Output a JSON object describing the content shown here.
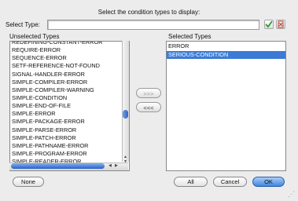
{
  "dialog": {
    "prompt": "Select the condition types to display:",
    "select_type_label": "Select Type:",
    "select_type_value": "",
    "unselected_label": "Unselected Types",
    "selected_label": "Selected Types",
    "unselected_items": [
      "REDEFINING-CONSTANT-ERROR",
      "REQUIRE-ERROR",
      "SEQUENCE-ERROR",
      "SETF-REFERENCE-NOT-FOUND",
      "SIGNAL-HANDLER-ERROR",
      "SIMPLE-COMPILER-ERROR",
      "SIMPLE-COMPILER-WARNING",
      "SIMPLE-CONDITION",
      "SIMPLE-END-OF-FILE",
      "SIMPLE-ERROR",
      "SIMPLE-PACKAGE-ERROR",
      "SIMPLE-PARSE-ERROR",
      "SIMPLE-PATCH-ERROR",
      "SIMPLE-PATHNAME-ERROR",
      "SIMPLE-PROGRAM-ERROR",
      "SIMPLE-READER-ERROR"
    ],
    "selected_items": [
      "ERROR",
      "SERIOUS-CONDITION"
    ],
    "selected_highlight_index": 1,
    "add_label": ">>>",
    "remove_label": "<<<",
    "none_label": "None",
    "all_label": "All",
    "cancel_label": "Cancel",
    "ok_label": "OK"
  },
  "icons": {
    "apply": "checkmark-icon",
    "clear": "clear-filter-icon"
  },
  "colors": {
    "selection": "#3b7bd6",
    "accent": "#3e85e0",
    "apply_icon": "#2e9a2e",
    "clear_icon": "#c0392b"
  }
}
